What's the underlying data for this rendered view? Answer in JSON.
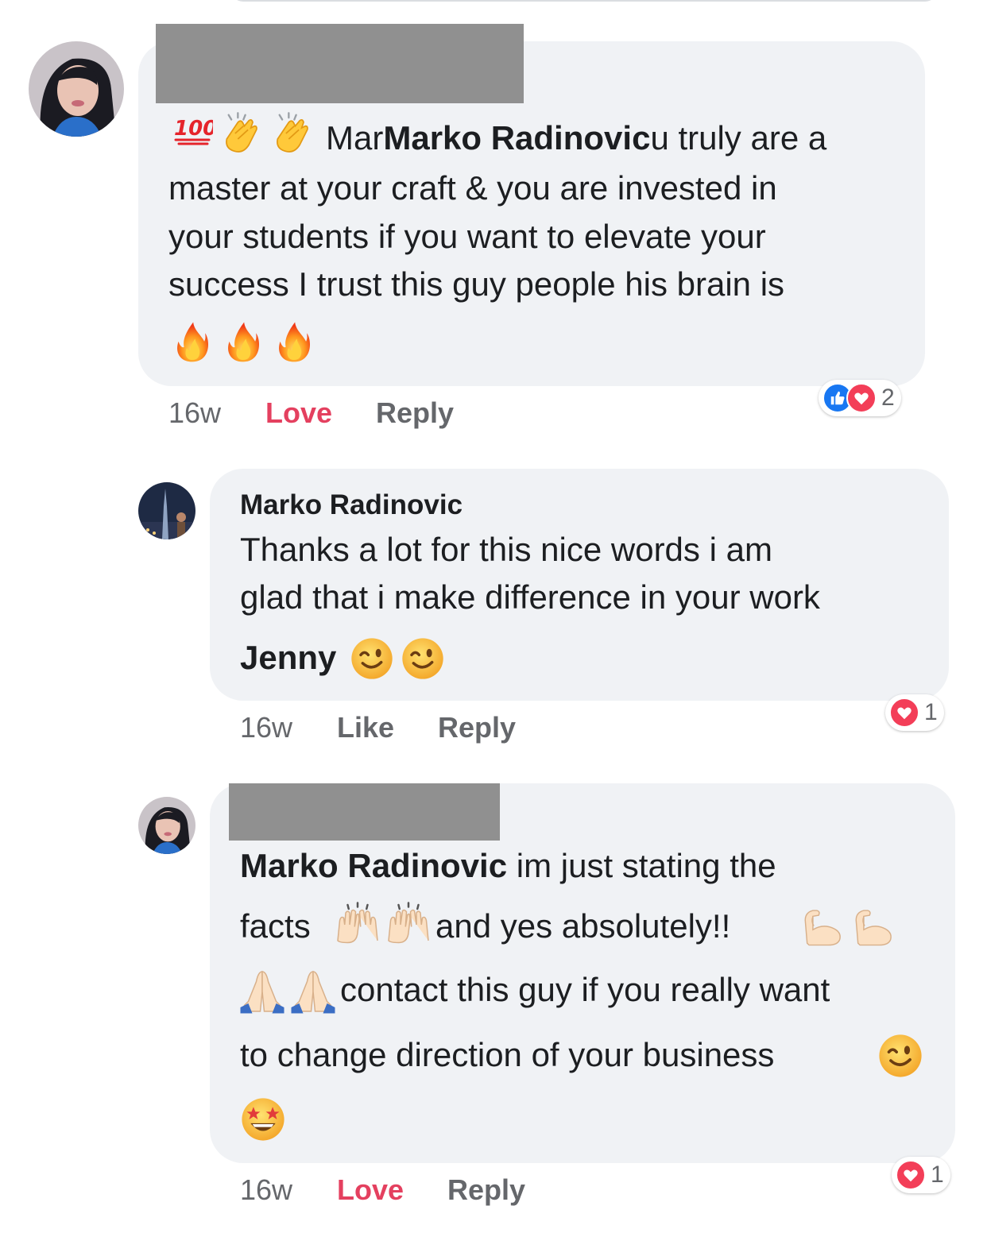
{
  "comments": [
    {
      "author": "",
      "lines": [
        {
          "segments": [
            {
              "type": "emoji",
              "name": "hundred-points-emoji"
            },
            {
              "type": "emoji",
              "name": "clapping-hands-emoji"
            },
            {
              "type": "emoji",
              "name": "clapping-hands-emoji"
            },
            {
              "type": "text",
              "value": " Mar"
            },
            {
              "type": "bold",
              "value": "Marko Radinovic"
            },
            {
              "type": "text",
              "value": "u truly are a"
            }
          ]
        },
        {
          "segments": [
            {
              "type": "text",
              "value": "master at your craft & you are invested in"
            }
          ]
        },
        {
          "segments": [
            {
              "type": "text",
              "value": "your students if you want to elevate your"
            }
          ]
        },
        {
          "segments": [
            {
              "type": "text",
              "value": "success I trust this guy people his brain is"
            }
          ]
        },
        {
          "segments": [
            {
              "type": "emoji",
              "name": "fire-emoji"
            },
            {
              "type": "emoji",
              "name": "fire-emoji"
            },
            {
              "type": "emoji",
              "name": "fire-emoji"
            }
          ]
        }
      ],
      "time": "16w",
      "action_label": "Love",
      "reply_label": "Reply",
      "reactions": [
        "like",
        "love"
      ],
      "reaction_count": "2"
    },
    {
      "author": "Marko Radinovic",
      "lines": [
        {
          "segments": [
            {
              "type": "text",
              "value": "Thanks a lot for this nice words i am"
            }
          ]
        },
        {
          "segments": [
            {
              "type": "text",
              "value": "glad that i make difference in your work"
            }
          ]
        },
        {
          "segments": [
            {
              "type": "bold",
              "value": "Jenny"
            },
            {
              "type": "emoji",
              "name": "winking-face-emoji"
            },
            {
              "type": "emoji",
              "name": "winking-face-emoji"
            }
          ]
        }
      ],
      "time": "16w",
      "action_label": "Like",
      "reply_label": "Reply",
      "reactions": [
        "love"
      ],
      "reaction_count": "1"
    },
    {
      "author": "",
      "lines": [
        {
          "segments": [
            {
              "type": "bold",
              "value": "Marko Radinovic"
            },
            {
              "type": "text",
              "value": " im just stating the"
            }
          ]
        },
        {
          "segments": [
            {
              "type": "text",
              "value": "facts "
            },
            {
              "type": "emoji",
              "name": "raising-hands-emoji"
            },
            {
              "type": "emoji",
              "name": "raising-hands-emoji"
            },
            {
              "type": "text",
              "value": " and yes absolutely!! "
            },
            {
              "type": "emoji",
              "name": "flexed-biceps-emoji"
            },
            {
              "type": "emoji",
              "name": "flexed-biceps-emoji"
            }
          ]
        },
        {
          "segments": [
            {
              "type": "emoji",
              "name": "folded-hands-emoji"
            },
            {
              "type": "emoji",
              "name": "folded-hands-emoji"
            },
            {
              "type": "text",
              "value": " contact this guy if you really want"
            }
          ]
        },
        {
          "segments": [
            {
              "type": "text",
              "value": "to change direction of your business "
            },
            {
              "type": "emoji",
              "name": "winking-face-emoji"
            }
          ]
        },
        {
          "segments": [
            {
              "type": "emoji",
              "name": "star-struck-emoji"
            }
          ]
        }
      ],
      "time": "16w",
      "action_label": "Love",
      "reply_label": "Reply",
      "reactions": [
        "love"
      ],
      "reaction_count": "1"
    }
  ]
}
